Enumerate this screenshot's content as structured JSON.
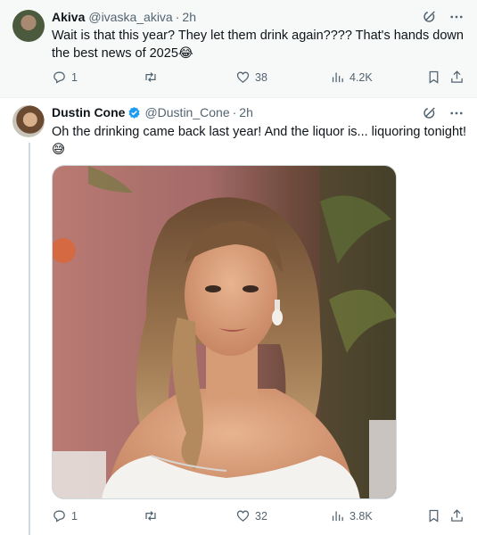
{
  "tweets": [
    {
      "author_name": "Akiva",
      "handle": "@ivaska_akiva",
      "separator": "·",
      "time": "2h",
      "text": "Wait is that this year? They let them drink again???? That's hands down the best news of 2025😂",
      "replies": "1",
      "likes": "38",
      "views": "4.2K",
      "verified": false
    },
    {
      "author_name": "Dustin Cone",
      "handle": "@Dustin_Cone",
      "separator": "·",
      "time": "2h",
      "text": "Oh the drinking came back last year! And the liquor is... liquoring tonight! 😅",
      "replies": "1",
      "likes": "32",
      "views": "3.8K",
      "verified": true,
      "media": "photo-woman-white-dress"
    }
  ],
  "icons": [
    "grok-icon",
    "more-icon",
    "reply-icon",
    "retweet-icon",
    "like-icon",
    "views-icon",
    "bookmark-icon",
    "share-icon"
  ],
  "colors": {
    "text": "#0f1419",
    "secondary": "#536471",
    "verified": "#1d9bf0",
    "thread_line": "#cfd9de"
  }
}
